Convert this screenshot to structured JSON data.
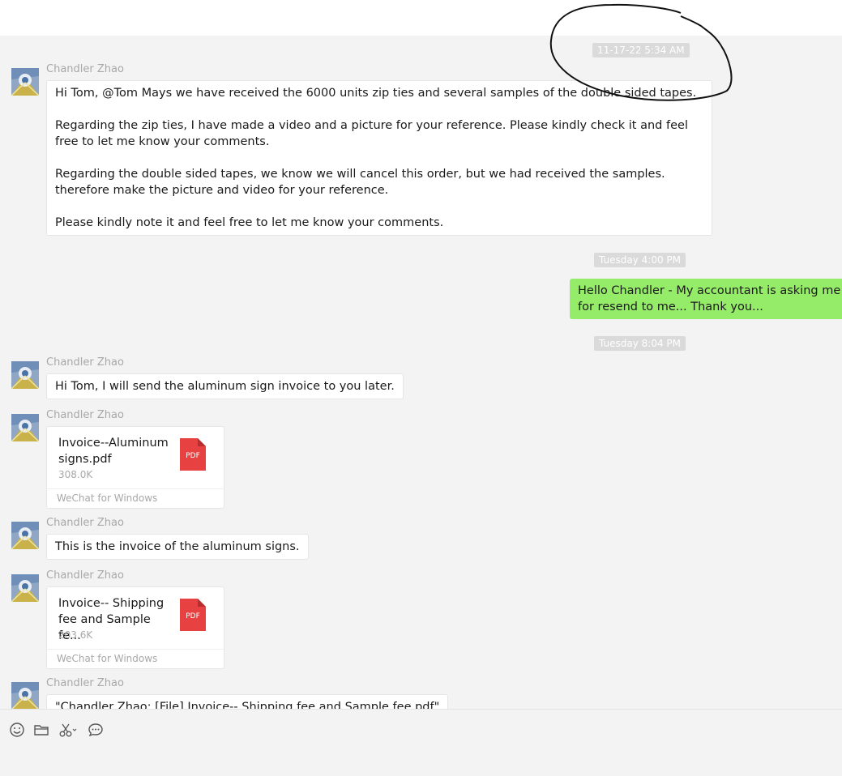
{
  "timestamps": [
    "11-17-22 5:34 AM",
    "Tuesday 4:00 PM",
    "Tuesday 8:04 PM"
  ],
  "messages": [
    {
      "sender": "Chandler Zhao",
      "paragraphs": [
        "Hi Tom, @Tom Mays we have received the 6000 units zip ties and several samples of the double sided tapes.",
        "Regarding the zip ties, I have made a video and a picture for your reference. Please kindly check it and feel free to let me know your comments.",
        "Regarding the double sided tapes, we know we will cancel this order, but we had received the samples. therefore make the picture and video for your reference.",
        "Please kindly note it and feel free to let me know your comments."
      ]
    },
    {
      "sender": "me",
      "text": "Hello Chandler - My accountant is asking me for resend to me... Thank you..."
    },
    {
      "sender": "Chandler Zhao",
      "text": "Hi Tom, I will send the aluminum sign invoice to you later."
    },
    {
      "sender": "Chandler Zhao",
      "file": {
        "name": "Invoice--Aluminum signs.pdf",
        "size": "308.0K",
        "source": "WeChat for Windows",
        "icon": "pdf-icon",
        "icon_label": "PDF"
      }
    },
    {
      "sender": "Chandler Zhao",
      "text": "This is the invoice of the aluminum signs."
    },
    {
      "sender": "Chandler Zhao",
      "file": {
        "name": "Invoice-- Shipping fee and Sample fe...",
        "size": "203.6K",
        "source": "WeChat for Windows",
        "icon": "pdf-icon",
        "icon_label": "PDF"
      }
    },
    {
      "sender": "Chandler Zhao",
      "text": "\"Chandler Zhao: [File] Invoice-- Shipping fee and Sample fee.pdf\""
    }
  ],
  "toolbar": [
    {
      "icon": "emoji-icon"
    },
    {
      "icon": "folder-icon"
    },
    {
      "icon": "scissors-icon"
    },
    {
      "icon": "chat-history-icon"
    }
  ],
  "colors": {
    "background": "#f3f3f3",
    "own_bubble": "#95ec69",
    "other_bubble": "#ffffff",
    "pdf_red": "#e84142",
    "timestamp_bg": "#dadada"
  }
}
